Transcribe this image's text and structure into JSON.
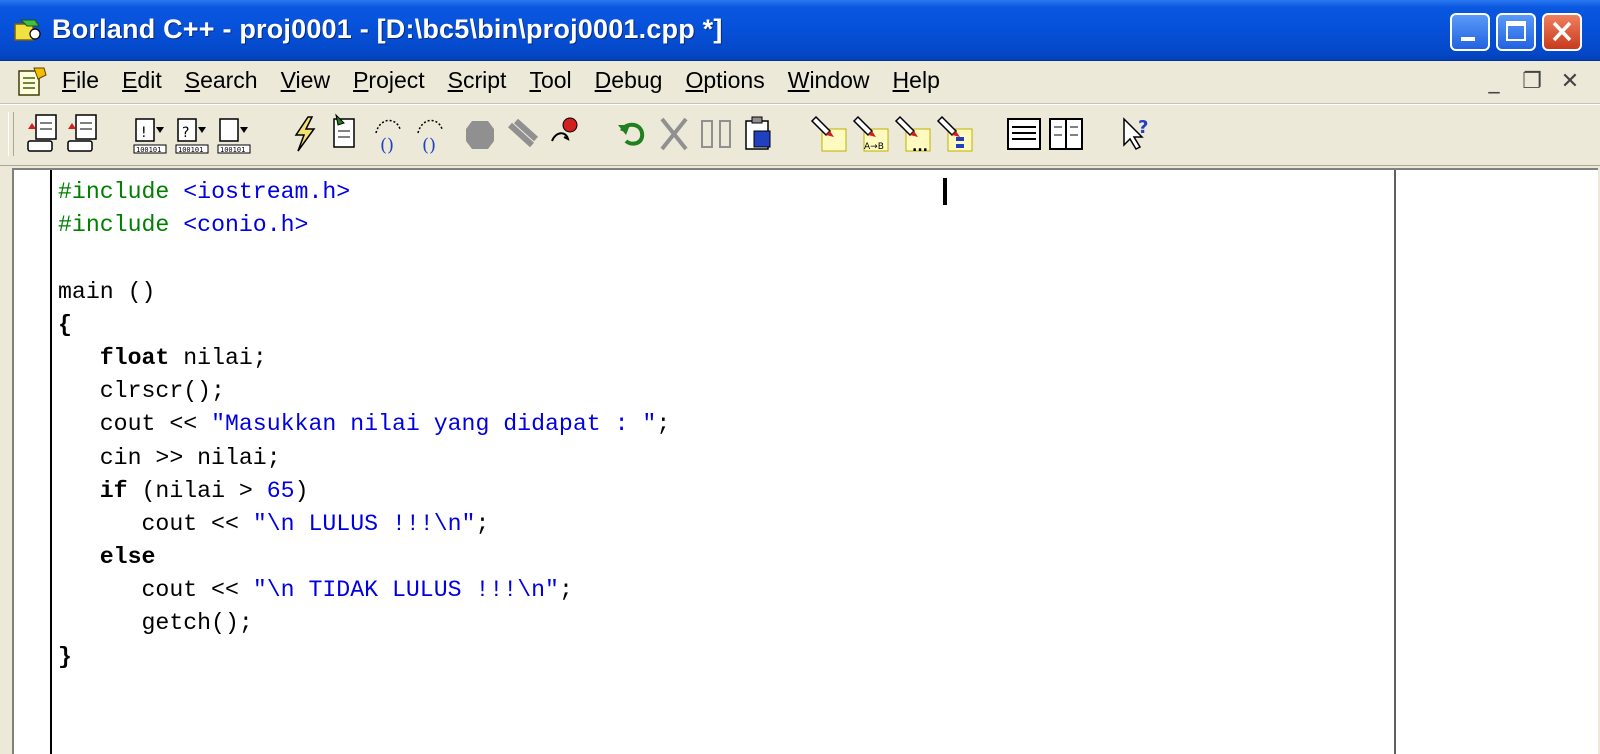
{
  "window": {
    "title": "Borland C++ - proj0001 - [D:\\bc5\\bin\\proj0001.cpp *]",
    "controls": [
      "minimize",
      "maximize",
      "close"
    ]
  },
  "menu": {
    "items": [
      {
        "label": "File"
      },
      {
        "label": "Edit"
      },
      {
        "label": "Search"
      },
      {
        "label": "View"
      },
      {
        "label": "Project"
      },
      {
        "label": "Script"
      },
      {
        "label": "Tool"
      },
      {
        "label": "Debug"
      },
      {
        "label": "Options"
      },
      {
        "label": "Window"
      },
      {
        "label": "Help"
      }
    ],
    "mdi_controls": {
      "minimize": "_",
      "restore": "❐",
      "close": "✕"
    }
  },
  "toolbar": {
    "buttons": [
      "open-project-icon",
      "save-project-icon",
      "new-target-icon",
      "speedmenu-target-icon",
      "add-node-icon",
      "make-lightning-icon",
      "build-node-icon",
      "step-over-icon",
      "trace-into-icon",
      "stop-icon",
      "pause-icon",
      "breakpoint-icon",
      "undo-icon",
      "cut-icon",
      "copy-icon",
      "paste-icon",
      "search-icon",
      "replace-icon",
      "search-again-icon",
      "browse-symbol-icon",
      "message-view-icon",
      "split-view-icon",
      "context-help-icon"
    ]
  },
  "editor": {
    "lines": [
      {
        "tokens": [
          {
            "t": "#include ",
            "c": "pp"
          },
          {
            "t": "<iostream.h>",
            "c": "inc"
          }
        ]
      },
      {
        "tokens": [
          {
            "t": "#include ",
            "c": "pp"
          },
          {
            "t": "<conio.h>",
            "c": "inc"
          }
        ]
      },
      {
        "tokens": []
      },
      {
        "tokens": [
          {
            "t": "main ()",
            "c": ""
          }
        ]
      },
      {
        "tokens": [
          {
            "t": "{",
            "c": "kw"
          }
        ]
      },
      {
        "tokens": [
          {
            "t": "   ",
            "c": ""
          },
          {
            "t": "float",
            "c": "kw"
          },
          {
            "t": " nilai;",
            "c": ""
          }
        ]
      },
      {
        "tokens": [
          {
            "t": "   clrscr();",
            "c": ""
          }
        ]
      },
      {
        "tokens": [
          {
            "t": "   cout << ",
            "c": ""
          },
          {
            "t": "\"Masukkan nilai yang didapat : \"",
            "c": "str"
          },
          {
            "t": ";",
            "c": ""
          }
        ]
      },
      {
        "tokens": [
          {
            "t": "   cin >> nilai;",
            "c": ""
          }
        ]
      },
      {
        "tokens": [
          {
            "t": "   ",
            "c": ""
          },
          {
            "t": "if",
            "c": "kw"
          },
          {
            "t": " (nilai > ",
            "c": ""
          },
          {
            "t": "65",
            "c": "num"
          },
          {
            "t": ")",
            "c": ""
          }
        ]
      },
      {
        "tokens": [
          {
            "t": "      cout << ",
            "c": ""
          },
          {
            "t": "\"\\n LULUS !!!\\n\"",
            "c": "str"
          },
          {
            "t": ";",
            "c": ""
          }
        ]
      },
      {
        "tokens": [
          {
            "t": "   ",
            "c": ""
          },
          {
            "t": "else",
            "c": "kw"
          }
        ]
      },
      {
        "tokens": [
          {
            "t": "      cout << ",
            "c": ""
          },
          {
            "t": "\"\\n TIDAK LULUS !!!\\n\"",
            "c": "str"
          },
          {
            "t": ";",
            "c": ""
          }
        ]
      },
      {
        "tokens": [
          {
            "t": "      getch();",
            "c": ""
          }
        ]
      },
      {
        "tokens": [
          {
            "t": "}",
            "c": "kw"
          }
        ]
      }
    ]
  },
  "colors": {
    "titlebar": "#0650d8",
    "preprocessor": "#008000",
    "string": "#0000e0",
    "text": "#000000",
    "window_face": "#ece9d8"
  }
}
